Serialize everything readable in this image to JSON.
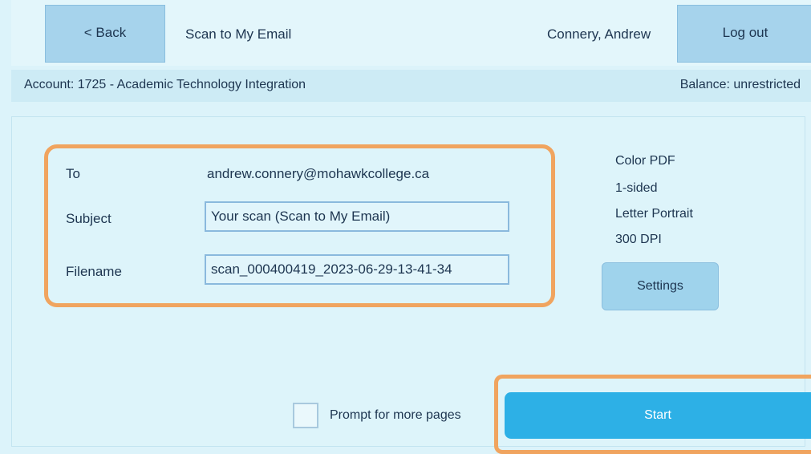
{
  "header": {
    "back_label": "< Back",
    "title": "Scan to My Email",
    "user_name": "Connery, Andrew",
    "logout_label": "Log out"
  },
  "account": {
    "account_text": "Account: 1725 - Academic Technology Integration",
    "balance_text": "Balance: unrestricted"
  },
  "form": {
    "to_label": "To",
    "to_value": "andrew.connery@mohawkcollege.ca",
    "subject_label": "Subject",
    "subject_value": "Your scan (Scan to My Email)",
    "filename_label": "Filename",
    "filename_value": "scan_000400419_2023-06-29-13-41-34"
  },
  "scan_settings": {
    "format": "Color PDF",
    "sides": "1-sided",
    "paper": "Letter Portrait",
    "resolution": "300 DPI",
    "settings_label": "Settings"
  },
  "footer": {
    "prompt_label": "Prompt for more pages",
    "prompt_checked": false,
    "start_label": "Start"
  },
  "colors": {
    "highlight": "#f0a45f",
    "start_button": "#2db0e6",
    "background": "#dcf3fa"
  }
}
